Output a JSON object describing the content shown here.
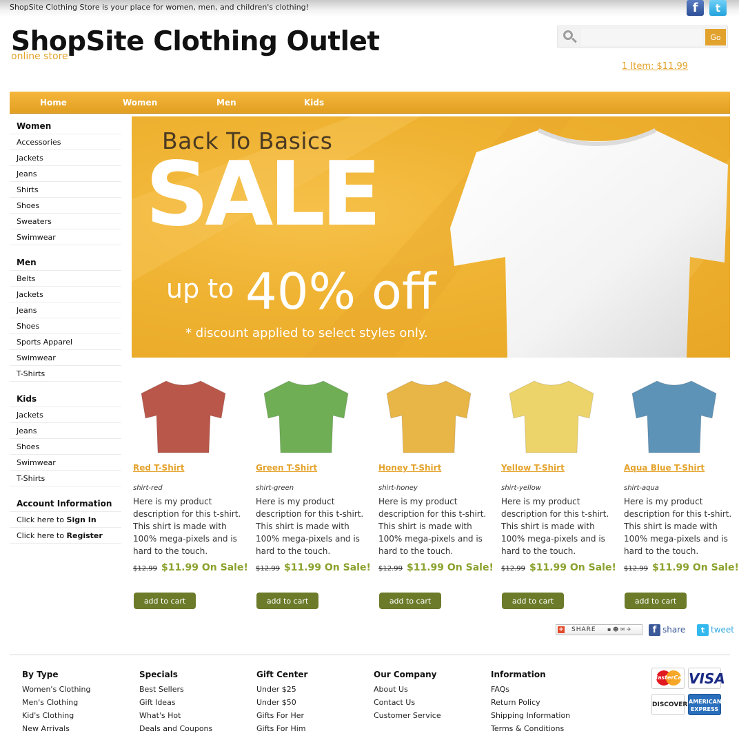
{
  "header": {
    "tagline": "ShopSite Clothing Store is your place for women, men, and children's clothing!",
    "site_title": "ShopSite Clothing Outlet",
    "site_subtitle": "online store",
    "search_placeholder": "",
    "go_label": "Go",
    "cart_link": "1 Item: $11.99",
    "facebook_icon": "f",
    "twitter_icon": "t"
  },
  "nav": [
    "Home",
    "Women",
    "Men",
    "Kids"
  ],
  "sidebar": {
    "women_head": "Women",
    "women": [
      "Accessories",
      "Jackets",
      "Jeans",
      "Shirts",
      "Shoes",
      "Sweaters",
      "Swimwear"
    ],
    "men_head": "Men",
    "men": [
      "Belts",
      "Jackets",
      "Jeans",
      "Shoes",
      "Sports Apparel",
      "Swimwear",
      "T-Shirts"
    ],
    "kids_head": "Kids",
    "kids": [
      "Jackets",
      "Jeans",
      "Shoes",
      "Swimwear",
      "T-Shirts"
    ],
    "account_head": "Account Information",
    "click_here_to": "Click here to",
    "sign_in": "Sign In",
    "register": "Register"
  },
  "banner": {
    "title": "Back To Basics",
    "sale": "SALE",
    "up_to": "up to",
    "percent": "40% off",
    "note": "* discount applied to select styles only.",
    "colors": {
      "bg": "#efb231",
      "text_dark": "#4b3a22"
    }
  },
  "products": [
    {
      "name": "Red T-Shirt",
      "sku": "shirt-red",
      "description": "Here is my product description for this t-shirt. This shirt is made with 100% mega-pixels and is hard to the touch.",
      "old_price": "$12.99",
      "sale_price": "$11.99 On Sale!",
      "add_label": "add to cart",
      "color": "#b9574a"
    },
    {
      "name": "Green T-Shirt",
      "sku": "shirt-green",
      "description": "Here is my product description for this t-shirt. This shirt is made with 100% mega-pixels and is hard to the touch.",
      "old_price": "$12.99",
      "sale_price": "$11.99 On Sale!",
      "add_label": "add to cart",
      "color": "#6fae55"
    },
    {
      "name": "Honey T-Shirt",
      "sku": "shirt-honey",
      "description": "Here is my product description for this t-shirt. This shirt is made with 100% mega-pixels and is hard to the touch.",
      "old_price": "$12.99",
      "sale_price": "$11.99 On Sale!",
      "add_label": "add to cart",
      "color": "#e8b547"
    },
    {
      "name": "Yellow T-Shirt",
      "sku": "shirt-yellow",
      "description": "Here is my product description for this t-shirt. This shirt is made with 100% mega-pixels and is hard to the touch.",
      "old_price": "$12.99",
      "sale_price": "$11.99 On Sale!",
      "add_label": "add to cart",
      "color": "#ecd36a"
    },
    {
      "name": "Aqua Blue T-Shirt",
      "sku": "shirt-aqua",
      "description": "Here is my product description for this t-shirt. This shirt is made with 100% mega-pixels and is hard to the touch.",
      "old_price": "$12.99",
      "sale_price": "$11.99 On Sale!",
      "add_label": "add to cart",
      "color": "#5e93b8"
    }
  ],
  "share": {
    "share_label": "SHARE",
    "facebook_label": "share",
    "twitter_label": "tweet"
  },
  "footer": {
    "columns": [
      {
        "head": "By Type",
        "links": [
          "Women's Clothing",
          "Men's Clothing",
          "Kid's Clothing",
          "New Arrivals"
        ]
      },
      {
        "head": "Specials",
        "links": [
          "Best Sellers",
          "Gift Ideas",
          "What's Hot",
          "Deals and Coupons"
        ]
      },
      {
        "head": "Gift Center",
        "links": [
          "Under $25",
          "Under $50",
          "Gifts For Her",
          "Gifts For Him"
        ]
      },
      {
        "head": "Our Company",
        "links": [
          "About Us",
          "Contact Us",
          "Customer Service"
        ]
      },
      {
        "head": "Information",
        "links": [
          "FAQs",
          "Return Policy",
          "Shipping Information",
          "Terms & Conditions"
        ]
      }
    ],
    "cards": {
      "mastercard": "MasterCard",
      "visa": "VISA",
      "discover": "DISCOVER",
      "amex": "AMERICAN EXPRESS"
    }
  },
  "colors": {
    "accent": "#e4a32c",
    "button": "#6c7b2a",
    "sale_green": "#8aa22d"
  }
}
